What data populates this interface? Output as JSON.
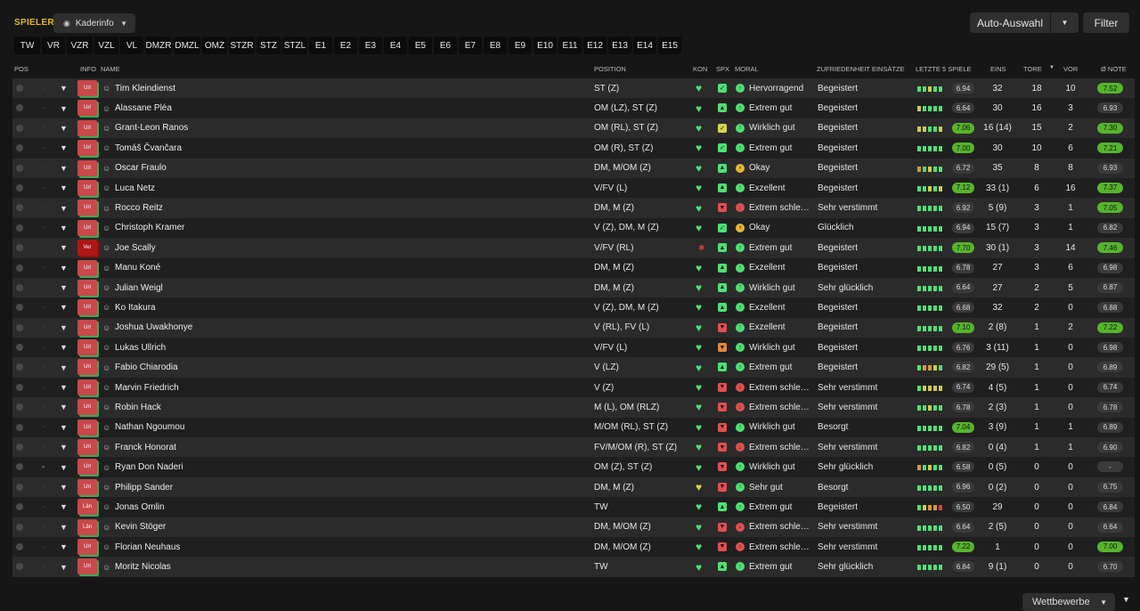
{
  "header": {
    "title": "SPIELER",
    "view_label": "Kaderinfo",
    "auto_label": "Auto-Auswahl",
    "filter_label": "Filter"
  },
  "positions": [
    "TW",
    "VR",
    "VZR",
    "VZL",
    "VL",
    "DMZR",
    "DMZL",
    "OMZ",
    "STZR",
    "STZ",
    "STZL",
    "E1",
    "E2",
    "E3",
    "E4",
    "E5",
    "E6",
    "E7",
    "E8",
    "E9",
    "E10",
    "E11",
    "E12",
    "E13",
    "E14",
    "E15"
  ],
  "columns": {
    "pos": "POS",
    "info": "INFO",
    "name": "NAME",
    "position": "POSITION",
    "kon": "KON",
    "spx": "SPX",
    "moral": "MORAL",
    "zufriedenheit": "ZUFRIEDENHEIT EINSÄTZE",
    "letzte": "LETZTE 5 SPIELE",
    "eins": "EINS",
    "tore": "TORE",
    "vor": "VOR",
    "note": "Ø NOTE"
  },
  "footer": {
    "competitions_label": "Wettbewerbe"
  },
  "colors": {
    "accent": "#e0b82e",
    "good": "#56b42c",
    "heart": "#4ee074",
    "bad": "#d83a3a"
  },
  "players": [
    {
      "pos": "-",
      "info": "Url",
      "name": "Tim Kleindienst",
      "position": "ST (Z)",
      "kon": "heart",
      "spx": "check",
      "moral_icon": "up",
      "moral": "Hervorragend",
      "zuf": "Begeistert",
      "form": [
        "g",
        "g",
        "y",
        "g",
        "g"
      ],
      "rating": "6.94",
      "rating_good": false,
      "eins": "32",
      "tore": "18",
      "vor": "10",
      "note": "7.52",
      "note_good": true
    },
    {
      "pos": "-",
      "info": "Url",
      "name": "Alassane Pléa",
      "position": "OM (LZ), ST (Z)",
      "kon": "heart",
      "spx": "up",
      "moral_icon": "up",
      "moral": "Extrem gut",
      "zuf": "Begeistert",
      "form": [
        "y",
        "g",
        "g",
        "g",
        "g"
      ],
      "rating": "6.64",
      "rating_good": false,
      "eins": "30",
      "tore": "16",
      "vor": "3",
      "note": "6.93",
      "note_good": false
    },
    {
      "pos": "-",
      "info": "Url",
      "name": "Grant-Leon Ranos",
      "position": "OM (RL), ST (Z)",
      "kon": "heart",
      "spx": "check-y",
      "moral_icon": "up",
      "moral": "Wirklich gut",
      "zuf": "Begeistert",
      "form": [
        "y",
        "y",
        "g",
        "g",
        "y"
      ],
      "rating": "7.06",
      "rating_good": true,
      "eins": "16 (14)",
      "tore": "15",
      "vor": "2",
      "note": "7.30",
      "note_good": true
    },
    {
      "pos": "-",
      "info": "Url",
      "name": "Tomáš Čvančara",
      "position": "OM (R), ST (Z)",
      "kon": "heart",
      "spx": "check",
      "moral_icon": "up",
      "moral": "Extrem gut",
      "zuf": "Begeistert",
      "form": [
        "g",
        "g",
        "g",
        "g",
        "g"
      ],
      "rating": "7.00",
      "rating_good": true,
      "eins": "30",
      "tore": "10",
      "vor": "6",
      "note": "7.21",
      "note_good": true
    },
    {
      "pos": "-",
      "info": "Url",
      "name": "Oscar Fraulo",
      "position": "DM, M/OM (Z)",
      "kon": "heart",
      "spx": "up",
      "moral_icon": "right",
      "moral": "Okay",
      "zuf": "Begeistert",
      "form": [
        "o",
        "g",
        "y",
        "g",
        "g"
      ],
      "rating": "6.72",
      "rating_good": false,
      "eins": "35",
      "tore": "8",
      "vor": "8",
      "note": "6.93",
      "note_good": false
    },
    {
      "pos": "-",
      "info": "Url",
      "name": "Luca Netz",
      "position": "V/FV (L)",
      "kon": "heart",
      "spx": "up",
      "moral_icon": "up",
      "moral": "Exzellent",
      "zuf": "Begeistert",
      "form": [
        "g",
        "g",
        "y",
        "g",
        "y"
      ],
      "rating": "7.12",
      "rating_good": true,
      "eins": "33 (1)",
      "tore": "6",
      "vor": "16",
      "note": "7.37",
      "note_good": true
    },
    {
      "pos": "-",
      "info": "Url",
      "name": "Rocco Reitz",
      "position": "DM, M (Z)",
      "kon": "heart",
      "spx": "down",
      "moral_icon": "down",
      "moral": "Extrem schle…",
      "zuf": "Sehr verstimmt",
      "form": [
        "g",
        "g",
        "g",
        "g",
        "g"
      ],
      "rating": "6.92",
      "rating_good": false,
      "eins": "5 (9)",
      "tore": "3",
      "vor": "1",
      "note": "7.05",
      "note_good": true
    },
    {
      "pos": "-",
      "info": "Url",
      "name": "Christoph Kramer",
      "position": "V (Z), DM, M (Z)",
      "kon": "heart",
      "spx": "check",
      "moral_icon": "right",
      "moral": "Okay",
      "zuf": "Glücklich",
      "form": [
        "g",
        "g",
        "g",
        "g",
        "g"
      ],
      "rating": "6.94",
      "rating_good": false,
      "eins": "15 (7)",
      "tore": "3",
      "vor": "1",
      "note": "6.82",
      "note_good": false
    },
    {
      "pos": "-",
      "info": "Ver",
      "name": "Joe Scally",
      "position": "V/FV (RL)",
      "kon": "injury",
      "spx": "up",
      "moral_icon": "up",
      "moral": "Extrem gut",
      "zuf": "Begeistert",
      "form": [
        "g",
        "g",
        "g",
        "g",
        "g"
      ],
      "rating": "7.70",
      "rating_good": true,
      "eins": "30 (1)",
      "tore": "3",
      "vor": "14",
      "note": "7.46",
      "note_good": true
    },
    {
      "pos": "-",
      "info": "Url",
      "name": "Manu Koné",
      "position": "DM, M (Z)",
      "kon": "heart",
      "spx": "up",
      "moral_icon": "up",
      "moral": "Exzellent",
      "zuf": "Begeistert",
      "form": [
        "g",
        "g",
        "g",
        "g",
        "g"
      ],
      "rating": "6.78",
      "rating_good": false,
      "eins": "27",
      "tore": "3",
      "vor": "6",
      "note": "6.98",
      "note_good": false
    },
    {
      "pos": "-",
      "info": "Url",
      "name": "Julian Weigl",
      "position": "DM, M (Z)",
      "kon": "heart",
      "spx": "up",
      "moral_icon": "up",
      "moral": "Wirklich gut",
      "zuf": "Sehr glücklich",
      "form": [
        "g",
        "g",
        "g",
        "g",
        "g"
      ],
      "rating": "6.64",
      "rating_good": false,
      "eins": "27",
      "tore": "2",
      "vor": "5",
      "note": "6.87",
      "note_good": false
    },
    {
      "pos": "-",
      "info": "Url",
      "name": "Ko Itakura",
      "position": "V (Z), DM, M (Z)",
      "kon": "heart",
      "spx": "up",
      "moral_icon": "up",
      "moral": "Exzellent",
      "zuf": "Begeistert",
      "form": [
        "g",
        "g",
        "g",
        "g",
        "g"
      ],
      "rating": "6.68",
      "rating_good": false,
      "eins": "32",
      "tore": "2",
      "vor": "0",
      "note": "6.88",
      "note_good": false
    },
    {
      "pos": "-",
      "info": "Url",
      "name": "Joshua Uwakhonye",
      "position": "V (RL), FV (L)",
      "kon": "heart",
      "spx": "down",
      "moral_icon": "up",
      "moral": "Exzellent",
      "zuf": "Begeistert",
      "form": [
        "g",
        "g",
        "g",
        "g",
        "g"
      ],
      "rating": "7.10",
      "rating_good": true,
      "eins": "2 (8)",
      "tore": "1",
      "vor": "2",
      "note": "7.22",
      "note_good": true
    },
    {
      "pos": "-",
      "info": "Url",
      "name": "Lukas Ullrich",
      "position": "V/FV (L)",
      "kon": "heart",
      "spx": "down-o",
      "moral_icon": "up",
      "moral": "Wirklich gut",
      "zuf": "Begeistert",
      "form": [
        "g",
        "g",
        "g",
        "g",
        "g"
      ],
      "rating": "6.76",
      "rating_good": false,
      "eins": "3 (11)",
      "tore": "1",
      "vor": "0",
      "note": "6.98",
      "note_good": false
    },
    {
      "pos": "-",
      "info": "Url",
      "name": "Fabio Chiarodia",
      "position": "V (LZ)",
      "kon": "heart",
      "spx": "up",
      "moral_icon": "up",
      "moral": "Extrem gut",
      "zuf": "Begeistert",
      "form": [
        "g",
        "o",
        "o",
        "y",
        "g"
      ],
      "rating": "6.82",
      "rating_good": false,
      "eins": "29 (5)",
      "tore": "1",
      "vor": "0",
      "note": "6.89",
      "note_good": false
    },
    {
      "pos": "-",
      "info": "Url",
      "name": "Marvin Friedrich",
      "position": "V (Z)",
      "kon": "heart",
      "spx": "down",
      "moral_icon": "down",
      "moral": "Extrem schle…",
      "zuf": "Sehr verstimmt",
      "form": [
        "g",
        "y",
        "y",
        "y",
        "y"
      ],
      "rating": "6.74",
      "rating_good": false,
      "eins": "4 (5)",
      "tore": "1",
      "vor": "0",
      "note": "6.74",
      "note_good": false
    },
    {
      "pos": "-",
      "info": "Url",
      "name": "Robin Hack",
      "position": "M (L), OM (RLZ)",
      "kon": "heart",
      "spx": "down",
      "moral_icon": "down",
      "moral": "Extrem schle…",
      "zuf": "Sehr verstimmt",
      "form": [
        "g",
        "g",
        "y",
        "g",
        "g"
      ],
      "rating": "6.78",
      "rating_good": false,
      "eins": "2 (3)",
      "tore": "1",
      "vor": "0",
      "note": "6.78",
      "note_good": false
    },
    {
      "pos": "-",
      "info": "Url",
      "name": "Nathan Ngoumou",
      "position": "M/OM (RL), ST (Z)",
      "kon": "heart",
      "spx": "down",
      "moral_icon": "up",
      "moral": "Wirklich gut",
      "zuf": "Besorgt",
      "form": [
        "g",
        "g",
        "g",
        "g",
        "g"
      ],
      "rating": "7.04",
      "rating_good": true,
      "eins": "3 (9)",
      "tore": "1",
      "vor": "1",
      "note": "6.89",
      "note_good": false
    },
    {
      "pos": "-",
      "info": "Url",
      "name": "Franck Honorat",
      "position": "FV/M/OM (R), ST (Z)",
      "kon": "heart",
      "spx": "down",
      "moral_icon": "down",
      "moral": "Extrem schle…",
      "zuf": "Sehr verstimmt",
      "form": [
        "g",
        "g",
        "g",
        "g",
        "g"
      ],
      "rating": "6.82",
      "rating_good": false,
      "eins": "0 (4)",
      "tore": "1",
      "vor": "1",
      "note": "6.90",
      "note_good": false
    },
    {
      "pos": "-",
      "info": "Url",
      "name": "Ryan Don Naderi",
      "position": "OM (Z), ST (Z)",
      "kon": "heart",
      "spx": "down",
      "moral_icon": "up",
      "moral": "Wirklich gut",
      "zuf": "Sehr glücklich",
      "form": [
        "o",
        "g",
        "y",
        "g",
        "g"
      ],
      "rating": "6.58",
      "rating_good": false,
      "eins": "0 (5)",
      "tore": "0",
      "vor": "0",
      "note": "-",
      "note_good": false,
      "pos_dark": true
    },
    {
      "pos": "-",
      "info": "Url",
      "name": "Philipp Sander",
      "position": "DM, M (Z)",
      "kon": "heart-y",
      "spx": "down",
      "moral_icon": "up",
      "moral": "Sehr gut",
      "zuf": "Besorgt",
      "form": [
        "g",
        "g",
        "g",
        "g",
        "g"
      ],
      "rating": "6.96",
      "rating_good": false,
      "eins": "0 (2)",
      "tore": "0",
      "vor": "0",
      "note": "6.75",
      "note_good": false
    },
    {
      "pos": "-",
      "info": "Län",
      "name": "Jonas Omlin",
      "position": "TW",
      "kon": "heart",
      "spx": "up",
      "moral_icon": "up",
      "moral": "Extrem gut",
      "zuf": "Begeistert",
      "form": [
        "g",
        "y",
        "o",
        "o",
        "r"
      ],
      "rating": "6.50",
      "rating_good": false,
      "eins": "29",
      "tore": "0",
      "vor": "0",
      "note": "6.84",
      "note_good": false
    },
    {
      "pos": "-",
      "info": "Län",
      "name": "Kevin Stöger",
      "position": "DM, M/OM (Z)",
      "kon": "heart",
      "spx": "down",
      "moral_icon": "down",
      "moral": "Extrem schle…",
      "zuf": "Sehr verstimmt",
      "form": [
        "g",
        "g",
        "g",
        "g",
        "g"
      ],
      "rating": "6.64",
      "rating_good": false,
      "eins": "2 (5)",
      "tore": "0",
      "vor": "0",
      "note": "6.64",
      "note_good": false
    },
    {
      "pos": "-",
      "info": "Url",
      "name": "Florian Neuhaus",
      "position": "DM, M/OM (Z)",
      "kon": "heart",
      "spx": "down",
      "moral_icon": "down",
      "moral": "Extrem schle…",
      "zuf": "Sehr verstimmt",
      "form": [
        "g",
        "g",
        "g",
        "g",
        "g"
      ],
      "rating": "7.22",
      "rating_good": true,
      "eins": "1",
      "tore": "0",
      "vor": "0",
      "note": "7.00",
      "note_good": true
    },
    {
      "pos": "-",
      "info": "Url",
      "name": "Moritz Nicolas",
      "position": "TW",
      "kon": "heart",
      "spx": "up",
      "moral_icon": "up",
      "moral": "Extrem gut",
      "zuf": "Sehr glücklich",
      "form": [
        "g",
        "g",
        "g",
        "g",
        "g"
      ],
      "rating": "6.84",
      "rating_good": false,
      "eins": "9 (1)",
      "tore": "0",
      "vor": "0",
      "note": "6.70",
      "note_good": false
    }
  ]
}
